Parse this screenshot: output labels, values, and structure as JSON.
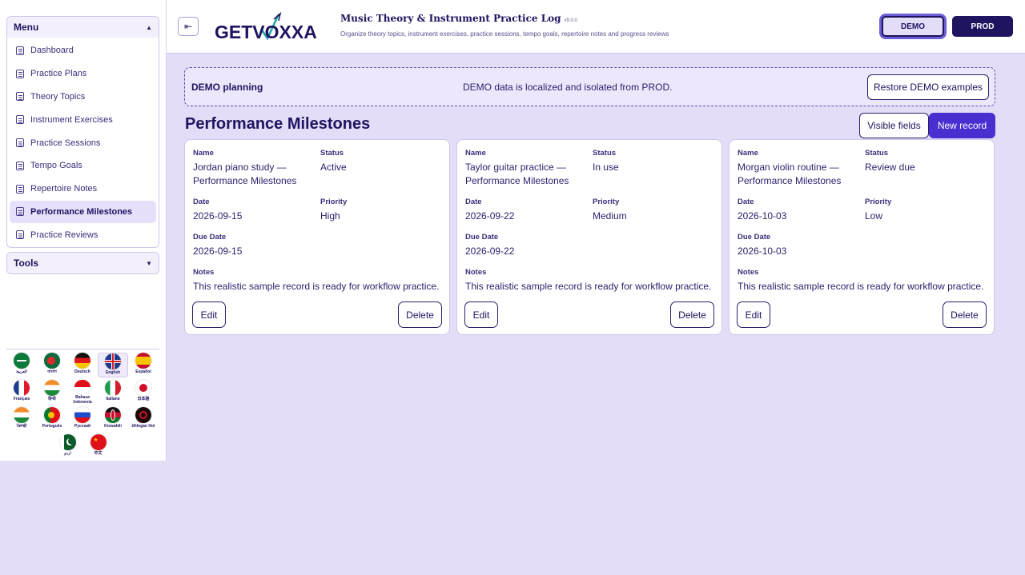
{
  "sidebar": {
    "menu_title": "Menu",
    "tools_title": "Tools",
    "items": [
      {
        "label": "Dashboard"
      },
      {
        "label": "Practice Plans"
      },
      {
        "label": "Theory Topics"
      },
      {
        "label": "Instrument Exercises"
      },
      {
        "label": "Practice Sessions"
      },
      {
        "label": "Tempo Goals"
      },
      {
        "label": "Repertoire Notes"
      },
      {
        "label": "Performance Milestones",
        "active": true
      },
      {
        "label": "Practice Reviews"
      }
    ],
    "languages": [
      {
        "name": "العربية",
        "flag": "sa-flag"
      },
      {
        "name": "বাংলা",
        "flag": "bd-flag"
      },
      {
        "name": "Deutsch",
        "flag": "de-flag"
      },
      {
        "name": "English",
        "flag": "gb-flag",
        "selected": true
      },
      {
        "name": "Español",
        "flag": "es-flag"
      },
      {
        "name": "Français",
        "flag": "fr-flag"
      },
      {
        "name": "हिन्दी",
        "flag": "in-flag"
      },
      {
        "name": "Bahasa Indonesia",
        "flag": "id-flag"
      },
      {
        "name": "Italiano",
        "flag": "it-flag"
      },
      {
        "name": "日本語",
        "flag": "jp-flag"
      },
      {
        "name": "ਪੰਜਾਬੀ",
        "flag": "in-flag"
      },
      {
        "name": "Português",
        "flag": "pt-flag"
      },
      {
        "name": "Русский",
        "flag": "ru-flag"
      },
      {
        "name": "Kiswahili",
        "flag": "ke-flag"
      },
      {
        "name": "tlhIngan Hol",
        "flag": "klingon-flag"
      },
      {
        "name": "اردو",
        "flag": "pk-flag"
      },
      {
        "name": "中文",
        "flag": "cn-flag"
      }
    ]
  },
  "header": {
    "logo_text": "GETVOXXA",
    "title": "Music Theory & Instrument Practice Log",
    "version": "v9.0.0",
    "subtitle": "Organize theory topics, instrument exercises, practice sessions, tempo goals, repertoire notes and progress reviews",
    "env_demo": "DEMO",
    "env_prod": "PROD"
  },
  "banner": {
    "title": "DEMO planning",
    "text": "DEMO data is localized and isolated from PROD.",
    "restore_label": "Restore DEMO examples"
  },
  "page": {
    "title": "Performance Milestones",
    "visible_fields_label": "Visible fields",
    "new_record_label": "New record"
  },
  "labels": {
    "name": "Name",
    "status": "Status",
    "date": "Date",
    "priority": "Priority",
    "due_date": "Due Date",
    "notes": "Notes",
    "edit": "Edit",
    "delete": "Delete"
  },
  "records": [
    {
      "name": "Jordan piano study — Performance Milestones",
      "status": "Active",
      "date": "2026-09-15",
      "priority": "High",
      "due_date": "2026-09-15",
      "notes": "This realistic sample record is ready for workflow practice."
    },
    {
      "name": "Taylor guitar practice — Performance Milestones",
      "status": "In use",
      "date": "2026-09-22",
      "priority": "Medium",
      "due_date": "2026-09-22",
      "notes": "This realistic sample record is ready for workflow practice."
    },
    {
      "name": "Morgan violin routine — Performance Milestones",
      "status": "Review due",
      "date": "2026-10-03",
      "priority": "Low",
      "due_date": "2026-10-03",
      "notes": "This realistic sample record is ready for workflow practice."
    }
  ],
  "colors": {
    "background": "#e3ddf8",
    "primary": "#1e1460",
    "accent": "#4a2fd0"
  }
}
